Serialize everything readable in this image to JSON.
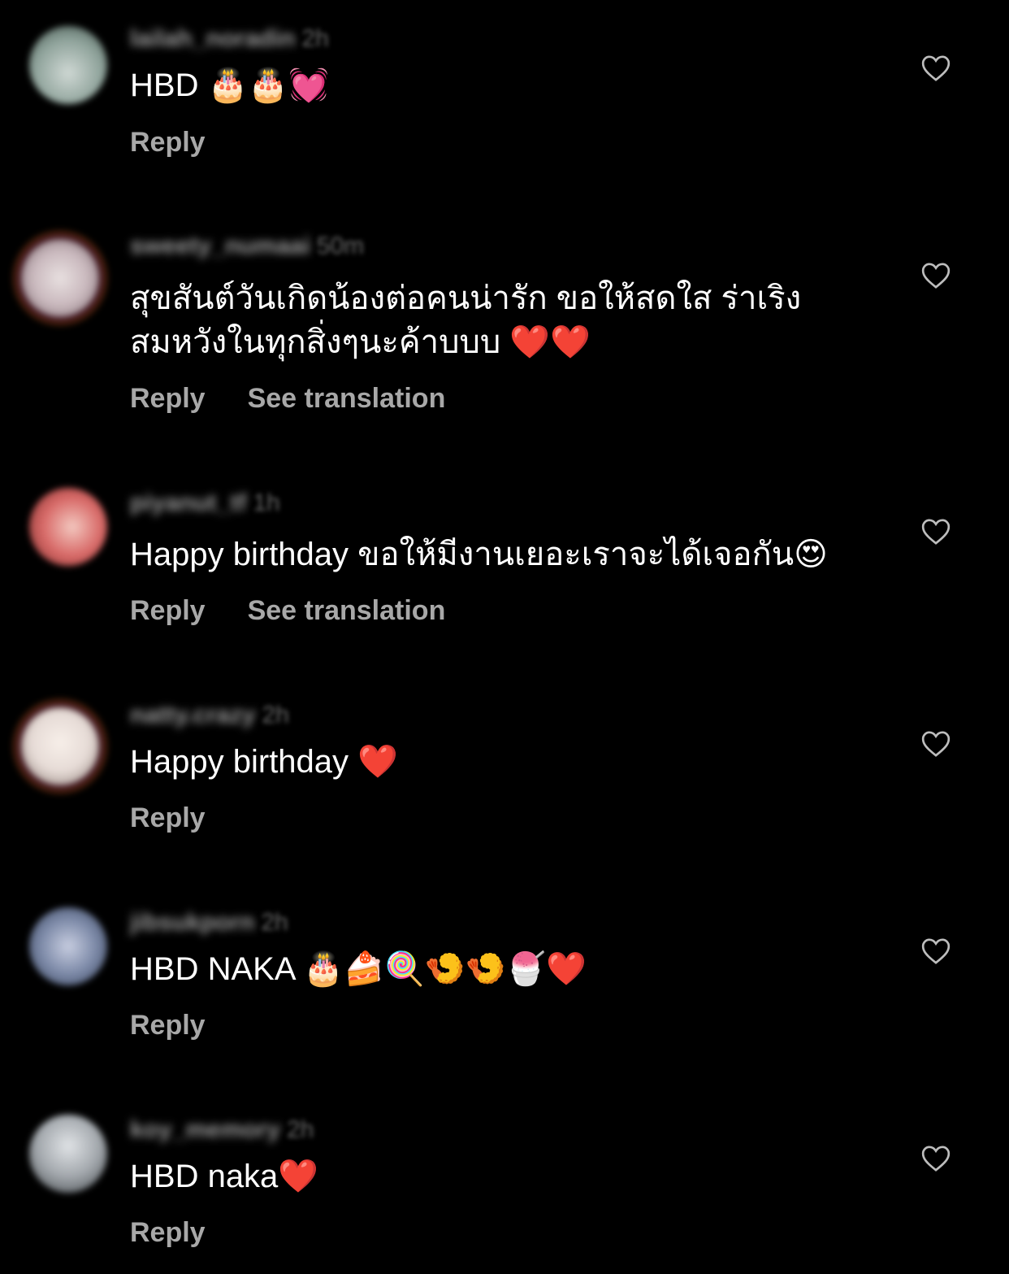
{
  "comments": [
    {
      "username": "lailah_noradin",
      "time": "2h",
      "text": "HBD 🎂🎂💓",
      "reply_label": "Reply",
      "see_translation": "",
      "avatar_color": "#8ea29a"
    },
    {
      "username": "sweety_numaai",
      "time": "50m",
      "text": "สุขสันต์วันเกิดน้องต่อคนน่ารัก ขอให้สดใส ร่าเริง\nสมหวังในทุกสิ่งๆนะค้าบบบ ❤️❤️",
      "reply_label": "Reply",
      "see_translation": "See translation",
      "avatar_color": "#c9b8bd"
    },
    {
      "username": "piyanut_tf",
      "time": "1h",
      "text": "Happy birthday ขอให้มีงานเยอะเราจะได้เจอกัน😍",
      "reply_label": "Reply",
      "see_translation": "See translation",
      "avatar_color": "#d86a68"
    },
    {
      "username": "natty.crazy",
      "time": "2h",
      "text": "Happy birthday ❤️",
      "reply_label": "Reply",
      "see_translation": "",
      "avatar_color": "#e6dbd6"
    },
    {
      "username": "jibsukporn",
      "time": "2h",
      "text": "HBD NAKA 🎂🍰🍭🍤🍤🍧❤️",
      "reply_label": "Reply",
      "see_translation": "",
      "avatar_color": "#7d8aa8"
    },
    {
      "username": "koy_memory",
      "time": "2h",
      "text": "HBD naka❤️",
      "reply_label": "Reply",
      "see_translation": "",
      "avatar_color": "#a3a8ad"
    }
  ],
  "icons": {
    "like": "heart-outline-icon"
  }
}
